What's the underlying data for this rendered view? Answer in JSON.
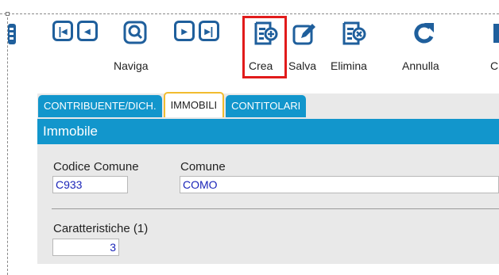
{
  "toolbar": {
    "naviga_label": "Naviga",
    "crea_label": "Crea",
    "salva_label": "Salva",
    "elimina_label": "Elimina",
    "annulla_label": "Annulla",
    "cut_label": "C"
  },
  "tabs": [
    {
      "label": "CONTRIBUENTE/DICH."
    },
    {
      "label": "IMMOBILI"
    },
    {
      "label": "CONTITOLARI"
    }
  ],
  "section": {
    "title": "Immobile"
  },
  "fields": {
    "codice_comune": {
      "label": "Codice Comune",
      "value": "C933"
    },
    "comune": {
      "label": "Comune",
      "value": "COMO"
    },
    "caratteristiche": {
      "label": "Caratteristiche (1)",
      "value": "3"
    }
  },
  "colors": {
    "accent": "#1296cc",
    "icon": "#1f5f9c",
    "highlight": "#e11b1b",
    "active_tab_border": "#f2bc2f"
  }
}
